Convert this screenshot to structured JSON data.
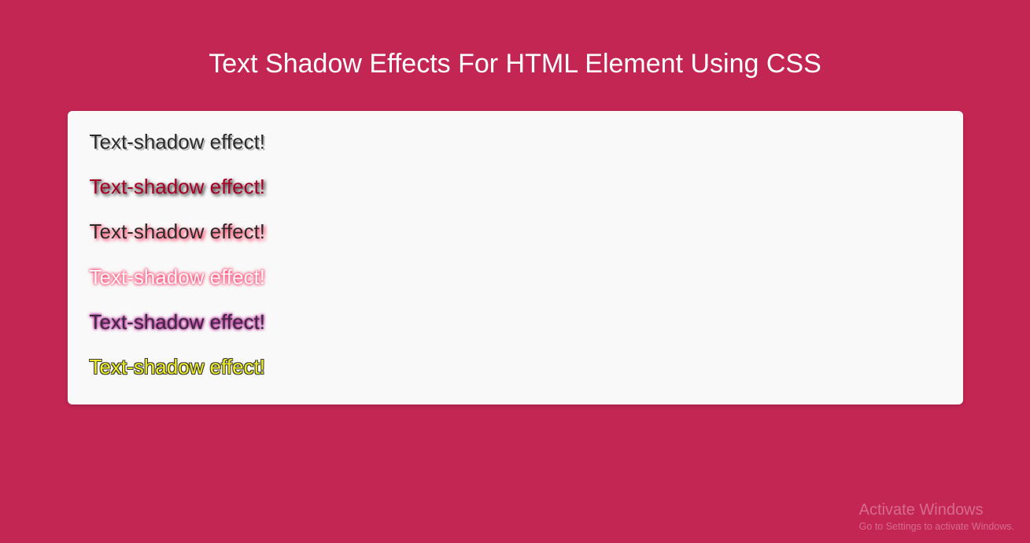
{
  "title": "Text Shadow Effects For HTML Element Using CSS",
  "effects": {
    "e1": "Text-shadow effect!",
    "e2": "Text-shadow effect!",
    "e3": "Text-shadow effect!",
    "e4": "Text-shadow effect!",
    "e5": "Text-shadow effect!",
    "e6": "Text-shadow effect!"
  },
  "watermark": {
    "title": "Activate Windows",
    "sub": "Go to Settings to activate Windows."
  }
}
